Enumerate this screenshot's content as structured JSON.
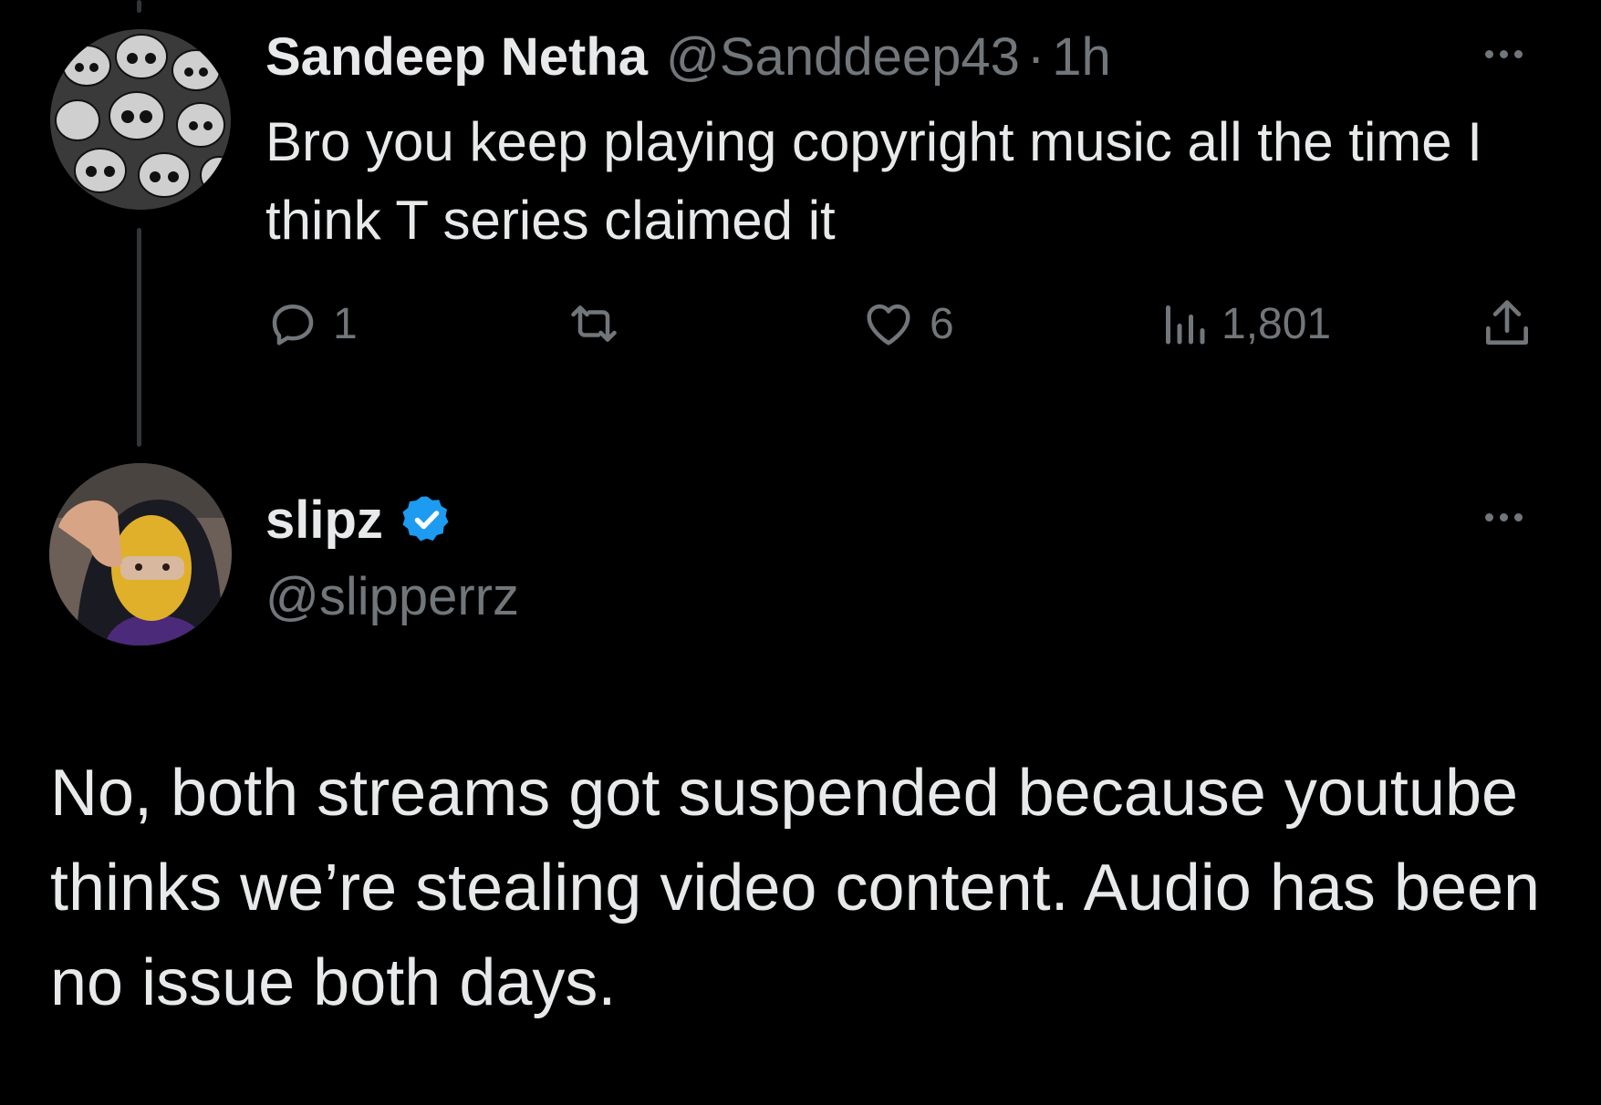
{
  "reply_tweet": {
    "author_name": "Sandeep Netha",
    "author_handle": "@Sanddeep43",
    "separator": "·",
    "time": "1h",
    "text": "Bro you keep playing copyright music all the time I think T series claimed it",
    "avatar": "skulls-avatar",
    "actions": {
      "reply_count": "1",
      "retweet_count": "",
      "like_count": "6",
      "view_count": "1,801"
    },
    "icons": [
      "reply-icon",
      "retweet-icon",
      "like-icon",
      "views-icon",
      "share-icon",
      "more-icon"
    ]
  },
  "main_tweet": {
    "author_name": "slipz",
    "author_handle": "@slipperrz",
    "verified": true,
    "avatar": "person-yellow-mask-avatar",
    "text": "No, both streams got suspended because youtube thinks we’re stealing video content. Audio has been no issue both days."
  },
  "colors": {
    "background": "#000000",
    "primary_text": "#e7e9ea",
    "secondary_text": "#71767b",
    "verified_badge": "#1d9bf0",
    "thread_line": "#333639"
  }
}
